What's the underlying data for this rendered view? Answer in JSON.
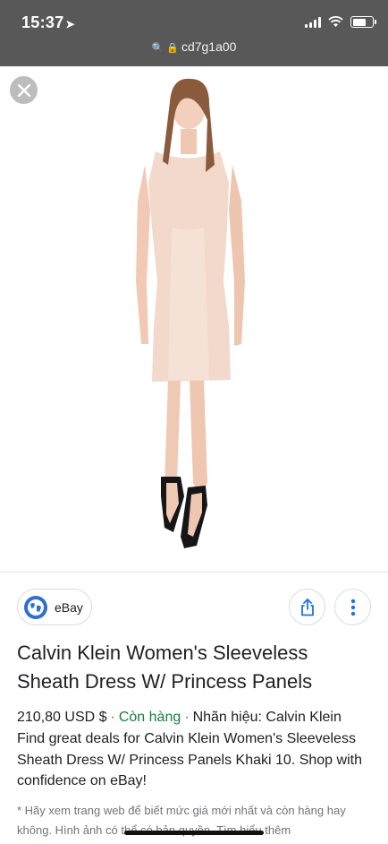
{
  "status": {
    "time": "15:37",
    "location_icon": "location-arrow-icon"
  },
  "browser": {
    "url": "cd7g1a00",
    "url_icons": [
      "search-icon",
      "lock-icon"
    ]
  },
  "image_viewer": {
    "close_icon": "close-icon",
    "image_alt": "Calvin Klein Women's Sleeveless Sheath Dress W/ Princess Panels"
  },
  "source": {
    "name": "eBay",
    "icon": "globe-icon"
  },
  "actions": {
    "share_icon": "share-icon",
    "more_icon": "more-vertical-icon"
  },
  "product": {
    "title": "Calvin Klein Women's Sleeveless Sheath Dress W/ Princess Panels",
    "price": "210,80 USD $",
    "availability": "Còn hàng",
    "brand": "Nhãn hiệu: Calvin Klein",
    "description": "Find great deals for Calvin Klein Women's Sleeveless Sheath Dress W/ Princess Panels Khaki 10. Shop with confidence on eBay!"
  },
  "note": "* Hãy xem trang web để biết mức giá mới nhất và còn hàng hay không. Hình ảnh có thể có bản quyền. Tìm hiểu thêm",
  "colors": {
    "status_bar": "#585858",
    "availability": "#188038",
    "source_globe": "#2f6fcf"
  }
}
